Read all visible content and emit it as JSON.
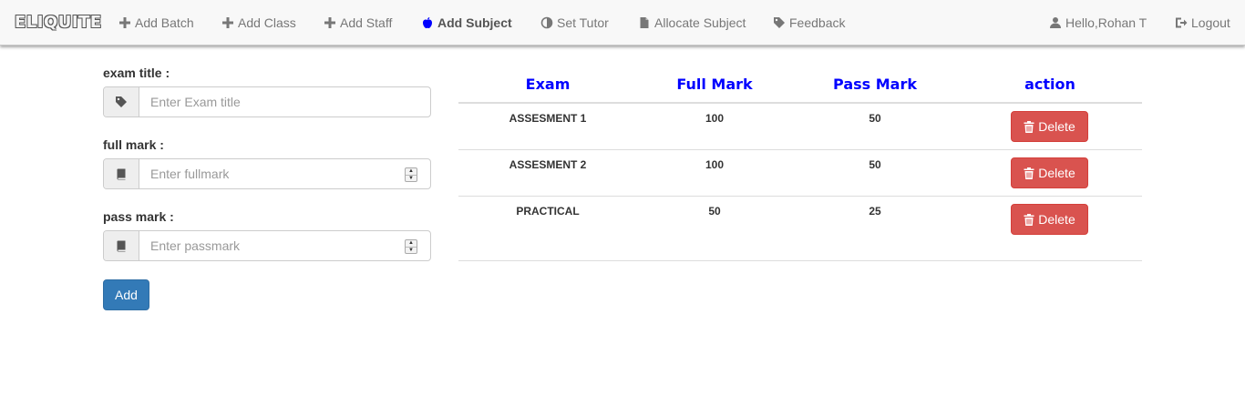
{
  "navbar": {
    "brand": "ELIQUITE",
    "items": [
      {
        "label": "Add Batch",
        "icon": "plus-icon"
      },
      {
        "label": "Add Class",
        "icon": "plus-icon"
      },
      {
        "label": "Add Staff",
        "icon": "plus-icon"
      },
      {
        "label": "Add Subject",
        "icon": "apple-icon",
        "active": true
      },
      {
        "label": "Set Tutor",
        "icon": "adjust-icon"
      },
      {
        "label": "Allocate Subject",
        "icon": "file-icon"
      },
      {
        "label": "Feedback",
        "icon": "tag-icon"
      }
    ],
    "user": {
      "label": "Hello,Rohan T",
      "icon": "user-icon"
    },
    "logout": {
      "label": "Logout",
      "icon": "logout-icon"
    }
  },
  "form": {
    "exam_title": {
      "label": "exam title :",
      "placeholder": "Enter Exam title",
      "value": "",
      "icon": "tag-icon"
    },
    "full_mark": {
      "label": "full mark :",
      "placeholder": "Enter fullmark",
      "value": "",
      "icon": "book-icon"
    },
    "pass_mark": {
      "label": "pass mark :",
      "placeholder": "Enter passmark",
      "value": "",
      "icon": "book-icon"
    },
    "add_label": "Add"
  },
  "table": {
    "headers": [
      "Exam",
      "Full Mark",
      "Pass Mark",
      "action"
    ],
    "rows": [
      {
        "exam": "ASSESMENT 1",
        "full": "100",
        "pass": "50",
        "action": "Delete"
      },
      {
        "exam": "ASSESMENT 2",
        "full": "100",
        "pass": "50",
        "action": "Delete"
      },
      {
        "exam": "PRACTICAL",
        "full": "50",
        "pass": "25",
        "action": "Delete"
      }
    ]
  },
  "colors": {
    "header_text": "#0000ff",
    "primary_button": "#337ab7",
    "danger_button": "#d9534f",
    "navbar_bg": "#f8f8f8"
  }
}
